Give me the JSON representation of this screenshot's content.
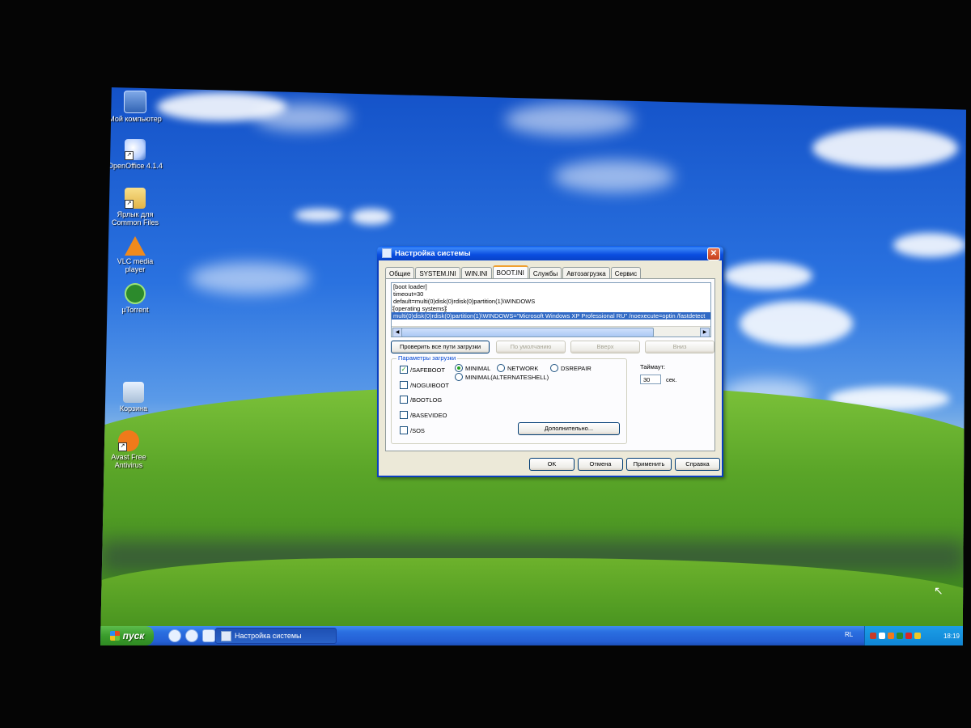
{
  "desktop": {
    "icons": [
      {
        "label": "Мой компьютер",
        "icon": "computer-icon"
      },
      {
        "label": "OpenOffice 4.1.4",
        "icon": "openoffice-icon"
      },
      {
        "label": "Ярлык для Common Files",
        "icon": "folder-icon"
      },
      {
        "label": "VLC media player",
        "icon": "vlc-icon"
      },
      {
        "label": "µTorrent",
        "icon": "utorrent-icon"
      },
      {
        "label": "Корзина",
        "icon": "recycle-bin-icon"
      },
      {
        "label": "Avast Free Antivirus",
        "icon": "avast-icon"
      }
    ]
  },
  "dialog": {
    "title": "Настройка системы",
    "tabs": [
      "Общие",
      "SYSTEM.INI",
      "WIN.INI",
      "BOOT.INI",
      "Службы",
      "Автозагрузка",
      "Сервис"
    ],
    "active_tab": "BOOT.INI",
    "bootini_lines": [
      "[boot loader]",
      "timeout=30",
      "default=multi(0)disk(0)rdisk(0)partition(1)\\WINDOWS",
      "[operating systems]",
      "multi(0)disk(0)rdisk(0)partition(1)\\WINDOWS=\"Microsoft Windows XP Professional RU\" /noexecute=optin /fastdetect"
    ],
    "buttons": {
      "check_paths": "Проверить все пути загрузки",
      "default": "По умолчанию",
      "up": "Вверх",
      "down": "Вниз",
      "advanced": "Дополнительно...",
      "ok": "OK",
      "cancel": "Отмена",
      "apply": "Применить",
      "help": "Справка"
    },
    "boot_options": {
      "label": "Параметры загрузки",
      "checkboxes": [
        {
          "label": "/SAFEBOOT",
          "checked": true
        },
        {
          "label": "/NOGUIBOOT",
          "checked": false
        },
        {
          "label": "/BOOTLOG",
          "checked": false
        },
        {
          "label": "/BASEVIDEO",
          "checked": false
        },
        {
          "label": "/SOS",
          "checked": false
        }
      ],
      "radios": [
        {
          "label": "MINIMAL",
          "selected": true
        },
        {
          "label": "NETWORK",
          "selected": false
        },
        {
          "label": "DSREPAIR",
          "selected": false
        },
        {
          "label": "MINIMAL(ALTERNATESHELL)",
          "selected": false
        }
      ]
    },
    "timeout": {
      "label": "Таймаут:",
      "value": "30",
      "unit": "сек."
    }
  },
  "taskbar": {
    "start_label": "пуск",
    "task_button": "Настройка системы",
    "language": "RL",
    "clock": "18:19"
  },
  "colors": {
    "titlebar": "#0a4ee0",
    "start_button": "#3a9c2c",
    "selection": "#316ac5"
  }
}
